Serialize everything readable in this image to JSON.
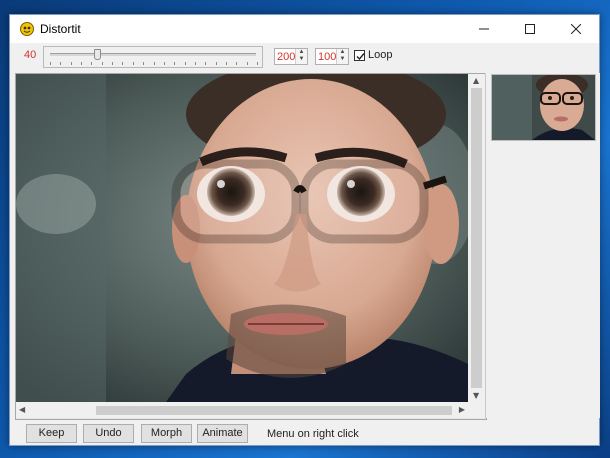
{
  "window": {
    "title": "Distortit"
  },
  "toolbar": {
    "slider_value_label": "40",
    "slider_fraction": 0.22,
    "spin1_value": "200",
    "spin2_value": "100",
    "loop_label": "Loop",
    "loop_checked": true
  },
  "bottom": {
    "buttons": [
      "Keep",
      "Undo",
      "Morph",
      "Animate"
    ],
    "hint": "Menu on right click"
  },
  "colors": {
    "accent_value_red": "#d0342c",
    "desktop_blue": "#0f5bb0"
  },
  "icons": {
    "app": "distortit-app-icon",
    "minimize": "minimize-icon",
    "maximize": "maximize-icon",
    "close": "close-icon"
  }
}
